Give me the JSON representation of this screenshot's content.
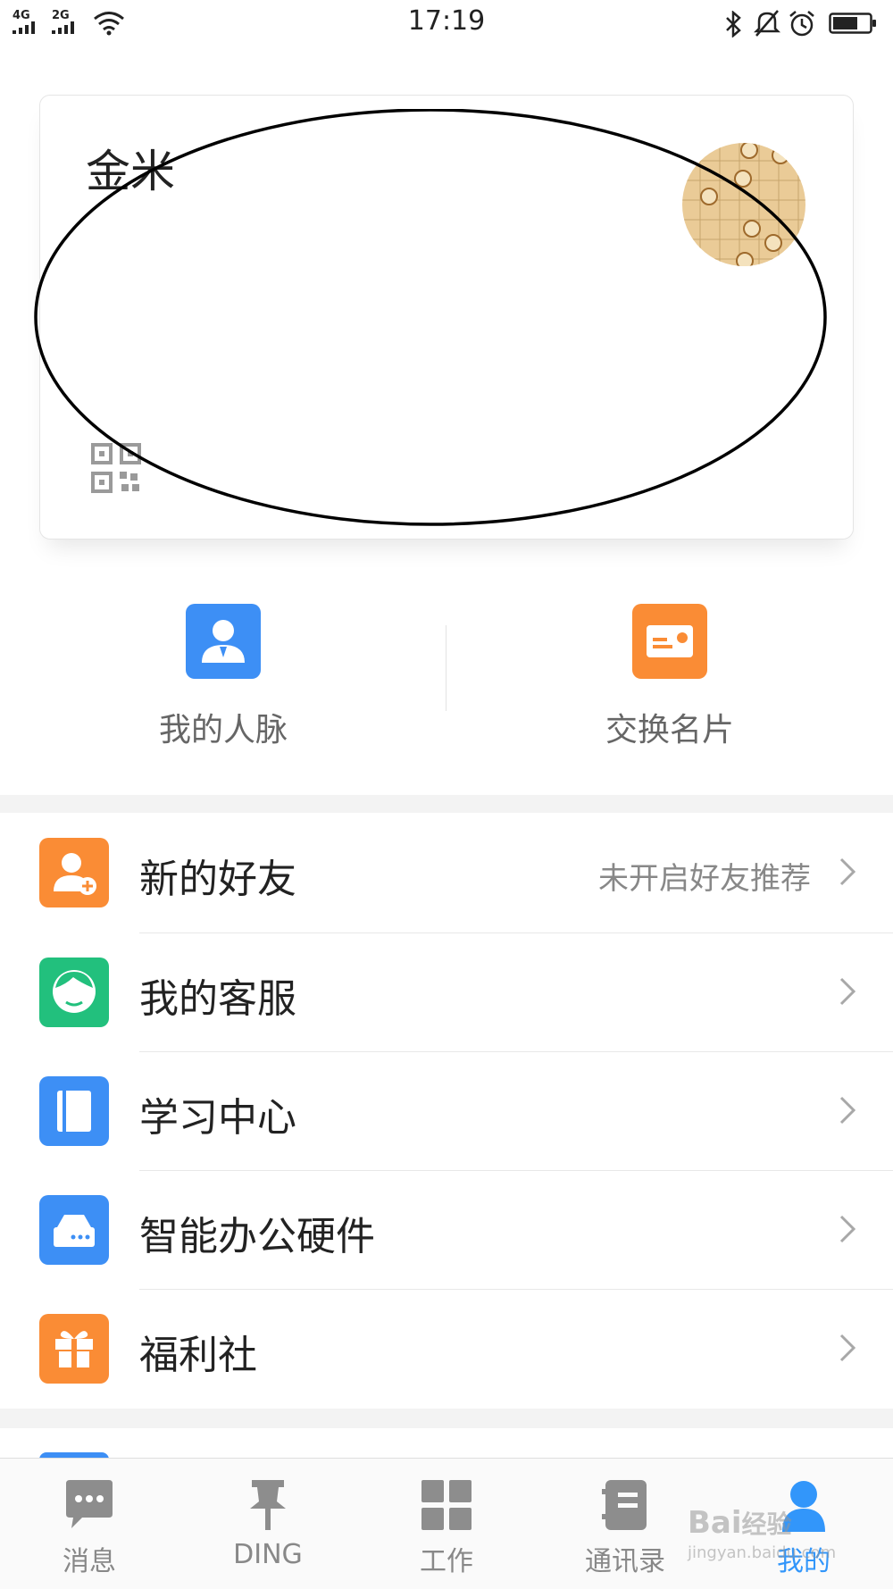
{
  "status_bar": {
    "signal1_label": "4G",
    "signal2_label": "2G",
    "time": "17:19"
  },
  "profile": {
    "name": "金米"
  },
  "shortcuts": [
    {
      "label": "我的人脉",
      "icon": "contacts-icon",
      "color": "#3d8ff5"
    },
    {
      "label": "交换名片",
      "icon": "business-card-icon",
      "color": "#fa8c35"
    }
  ],
  "menu": [
    {
      "label": "新的好友",
      "value": "未开启好友推荐",
      "icon": "add-friend-icon",
      "color": "#fa8c35"
    },
    {
      "label": "我的客服",
      "value": "",
      "icon": "customer-service-icon",
      "color": "#22c07d"
    },
    {
      "label": "学习中心",
      "value": "",
      "icon": "book-icon",
      "color": "#3d8ff5"
    },
    {
      "label": "智能办公硬件",
      "value": "",
      "icon": "office-hardware-icon",
      "color": "#3d8ff5"
    },
    {
      "label": "福利社",
      "value": "",
      "icon": "gift-icon",
      "color": "#fa8c35"
    }
  ],
  "tabbar": {
    "tabs": [
      {
        "label": "消息",
        "icon": "message-icon"
      },
      {
        "label": "DING",
        "icon": "pin-icon"
      },
      {
        "label": "工作",
        "icon": "grid-icon"
      },
      {
        "label": "通讯录",
        "icon": "address-book-icon"
      },
      {
        "label": "我的",
        "icon": "user-icon",
        "active": true
      }
    ],
    "active_color": "#3296fa",
    "inactive_color": "#888888"
  },
  "watermark": {
    "text1": "Bai",
    "text2": "经验",
    "text3": "jingyan.baidu.com"
  }
}
